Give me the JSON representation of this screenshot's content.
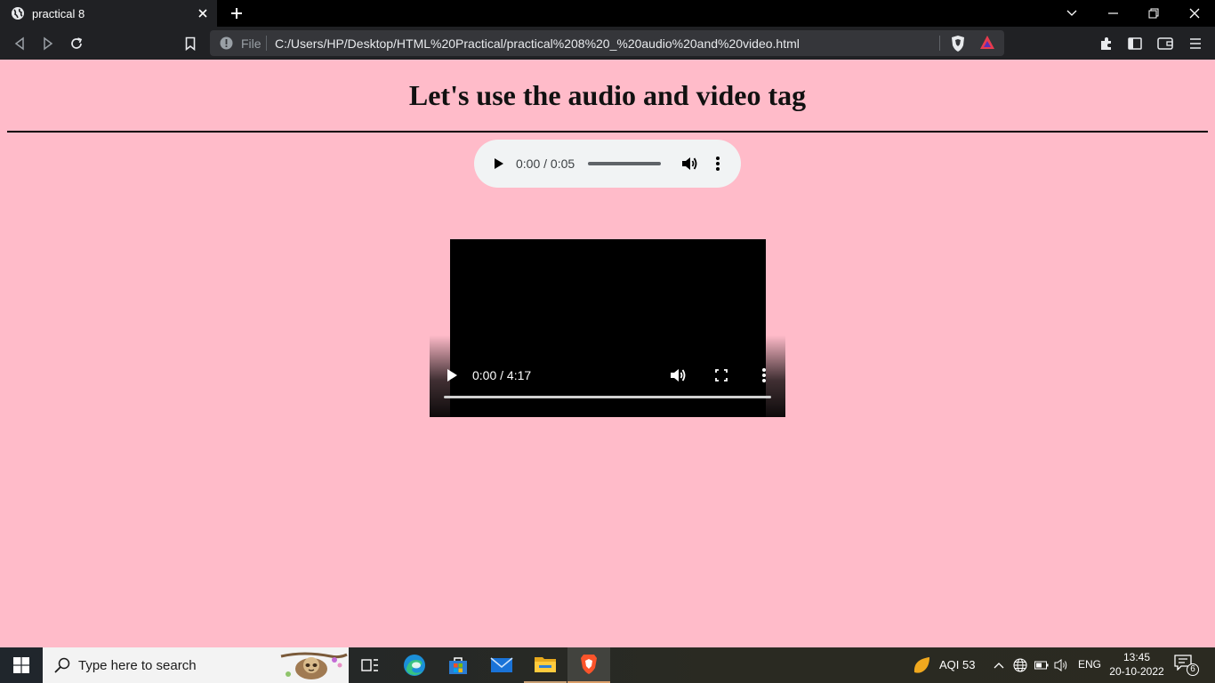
{
  "browser": {
    "tab": {
      "title": "practical 8"
    },
    "address_bar": {
      "scheme_label": "File",
      "url": "C:/Users/HP/Desktop/HTML%20Practical/practical%208%20_%20audio%20and%20video.html"
    }
  },
  "page": {
    "heading": "Let's use the audio and video tag",
    "background_color": "#ffbbc9",
    "audio_player": {
      "time": "0:00 / 0:05"
    },
    "video_player": {
      "time": "0:00 / 4:17"
    }
  },
  "taskbar": {
    "search_placeholder": "Type here to search",
    "weather": "AQI 53",
    "language": "ENG",
    "time": "13:45",
    "date": "20-10-2022",
    "notification_count": "6",
    "pinned_apps": [
      "task-view",
      "edge",
      "microsoft-store",
      "mail",
      "file-explorer",
      "brave"
    ]
  }
}
